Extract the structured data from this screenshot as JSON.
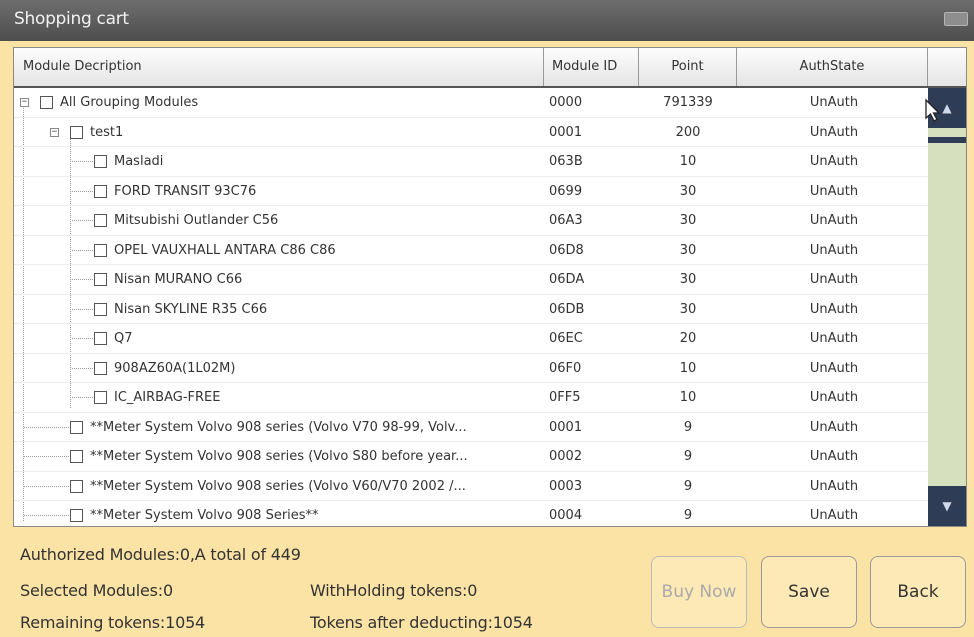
{
  "window": {
    "title": "Shopping cart"
  },
  "table": {
    "columns": [
      "Module Decription",
      "Module ID",
      "Point",
      "AuthState"
    ],
    "rows": [
      {
        "desc": "All Grouping Modules",
        "id": "0000",
        "point": "791339",
        "auth": "UnAuth",
        "level": 0,
        "expander": "⊟"
      },
      {
        "desc": "test1",
        "id": "0001",
        "point": "200",
        "auth": "UnAuth",
        "level": 1,
        "expander": "⊟"
      },
      {
        "desc": "Masladi",
        "id": "063B",
        "point": "10",
        "auth": "UnAuth",
        "level": 2
      },
      {
        "desc": "FORD  TRANSIT  93C76",
        "id": "0699",
        "point": "30",
        "auth": "UnAuth",
        "level": 2
      },
      {
        "desc": "Mitsubishi  Outlander C56",
        "id": "06A3",
        "point": "30",
        "auth": "UnAuth",
        "level": 2
      },
      {
        "desc": "OPEL VAUXHALL  ANTARA C86  C86",
        "id": "06D8",
        "point": "30",
        "auth": "UnAuth",
        "level": 2
      },
      {
        "desc": "Nisan MURANO   C66",
        "id": "06DA",
        "point": "30",
        "auth": "UnAuth",
        "level": 2
      },
      {
        "desc": "Nisan SKYLINE   R35 C66",
        "id": "06DB",
        "point": "30",
        "auth": "UnAuth",
        "level": 2
      },
      {
        "desc": "Q7",
        "id": "06EC",
        "point": "20",
        "auth": "UnAuth",
        "level": 2
      },
      {
        "desc": "908AZ60A(1L02M)",
        "id": "06F0",
        "point": "10",
        "auth": "UnAuth",
        "level": 2
      },
      {
        "desc": "IC_AIRBAG-FREE",
        "id": "0FF5",
        "point": "10",
        "auth": "UnAuth",
        "level": 2
      },
      {
        "desc": "**Meter System  Volvo 908 series (Volvo V70 98-99, Volv...",
        "id": "0001",
        "point": "9",
        "auth": "UnAuth",
        "level": 1
      },
      {
        "desc": "**Meter System  Volvo 908 series (Volvo S80 before year...",
        "id": "0002",
        "point": "9",
        "auth": "UnAuth",
        "level": 1
      },
      {
        "desc": "**Meter System  Volvo 908 series (Volvo V60/V70 2002 /...",
        "id": "0003",
        "point": "9",
        "auth": "UnAuth",
        "level": 1
      },
      {
        "desc": "**Meter System  Volvo 908 Series**",
        "id": "0004",
        "point": "9",
        "auth": "UnAuth",
        "level": 1
      }
    ]
  },
  "scroll": {
    "up_icon": "chevron-up-icon",
    "down_icon": "chevron-down-icon"
  },
  "footer": {
    "authorized": "Authorized Modules:0,A total of 449",
    "selected": "Selected Modules:0",
    "withholding": "WithHolding tokens:0",
    "remaining": "Remaining tokens:1054",
    "after": "Tokens after deducting:1054"
  },
  "buttons": {
    "buy": "Buy Now",
    "save": "Save",
    "back": "Back"
  },
  "colors": {
    "background": "#fbe3a6",
    "scroll_button": "#2e3c55",
    "scroll_track": "#d6e0bf"
  }
}
